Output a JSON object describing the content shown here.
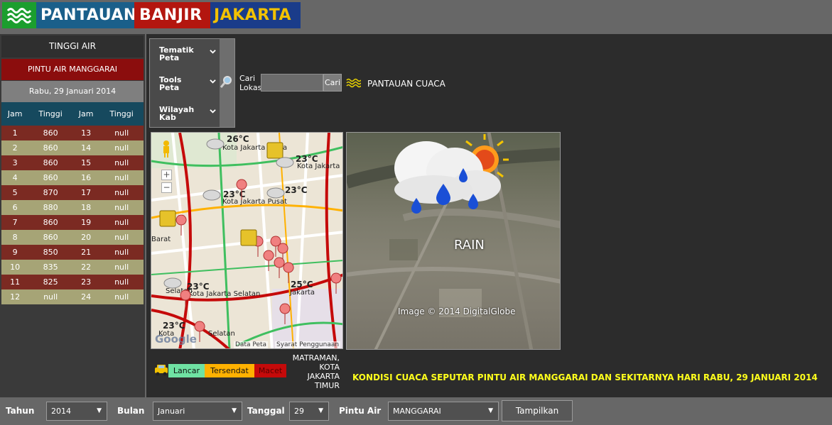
{
  "header": {
    "word1": "PANTAUAN",
    "word2": "BANJIR",
    "word3": "JAKARTA"
  },
  "sidebar": {
    "title": "TINGGI AIR",
    "gate": "PINTU AIR MANGGARAI",
    "date": "Rabu, 29 Januari 2014",
    "table": {
      "headers": [
        "Jam",
        "Tinggi",
        "Jam",
        "Tinggi"
      ],
      "rows": [
        [
          "1",
          "860",
          "13",
          "null"
        ],
        [
          "2",
          "860",
          "14",
          "null"
        ],
        [
          "3",
          "860",
          "15",
          "null"
        ],
        [
          "4",
          "860",
          "16",
          "null"
        ],
        [
          "5",
          "870",
          "17",
          "null"
        ],
        [
          "6",
          "880",
          "18",
          "null"
        ],
        [
          "7",
          "860",
          "19",
          "null"
        ],
        [
          "8",
          "860",
          "20",
          "null"
        ],
        [
          "9",
          "850",
          "21",
          "null"
        ],
        [
          "10",
          "835",
          "22",
          "null"
        ],
        [
          "11",
          "825",
          "23",
          "null"
        ],
        [
          "12",
          "null",
          "24",
          "null"
        ]
      ]
    }
  },
  "menu": {
    "items": [
      "Tematik Peta",
      "Tools Peta",
      "Wilayah Kab"
    ]
  },
  "search": {
    "label": "Cari Lokasi",
    "value": "",
    "button": "Cari",
    "weather_link": "PANTAUAN CUACA"
  },
  "map": {
    "labels": [
      "Kota Jakarta Utara",
      "Kota Jakarta",
      "Kota Jakarta Pusat",
      "Kota Jakarta Selatan",
      "Jakarta",
      "Selatan",
      "Barat",
      "Selatan",
      "Kota"
    ],
    "temps": [
      "26°C",
      "23°C",
      "23°C",
      "23°C",
      "23°C",
      "25°C",
      "23°C"
    ],
    "data_link": "Data Peta",
    "terms_link": "Syarat Penggunaan",
    "google": "Google"
  },
  "weather": {
    "condition": "RAIN",
    "credit": "Image © 2014 DigitalGlobe"
  },
  "legend": {
    "lancar": "Lancar",
    "tersendat": "Tersendat",
    "macet": "Macet",
    "colors": {
      "lancar": "#6fe2a3",
      "tersendat": "#ffb100",
      "macet": "#c50a0a"
    }
  },
  "location": "MATRAMAN, KOTA JAKARTA TIMUR",
  "condition_text": "KONDISI CUACA SEPUTAR PINTU AIR MANGGARAI DAN SEKITARNYA HARI RABU, 29 JANUARI 2014",
  "filters": {
    "year_label": "Tahun",
    "year": "2014",
    "month_label": "Bulan",
    "month": "Januari",
    "day_label": "Tanggal",
    "day": "29",
    "gate_label": "Pintu Air",
    "gate": "MANGGARAI",
    "show_button": "Tampilkan"
  }
}
